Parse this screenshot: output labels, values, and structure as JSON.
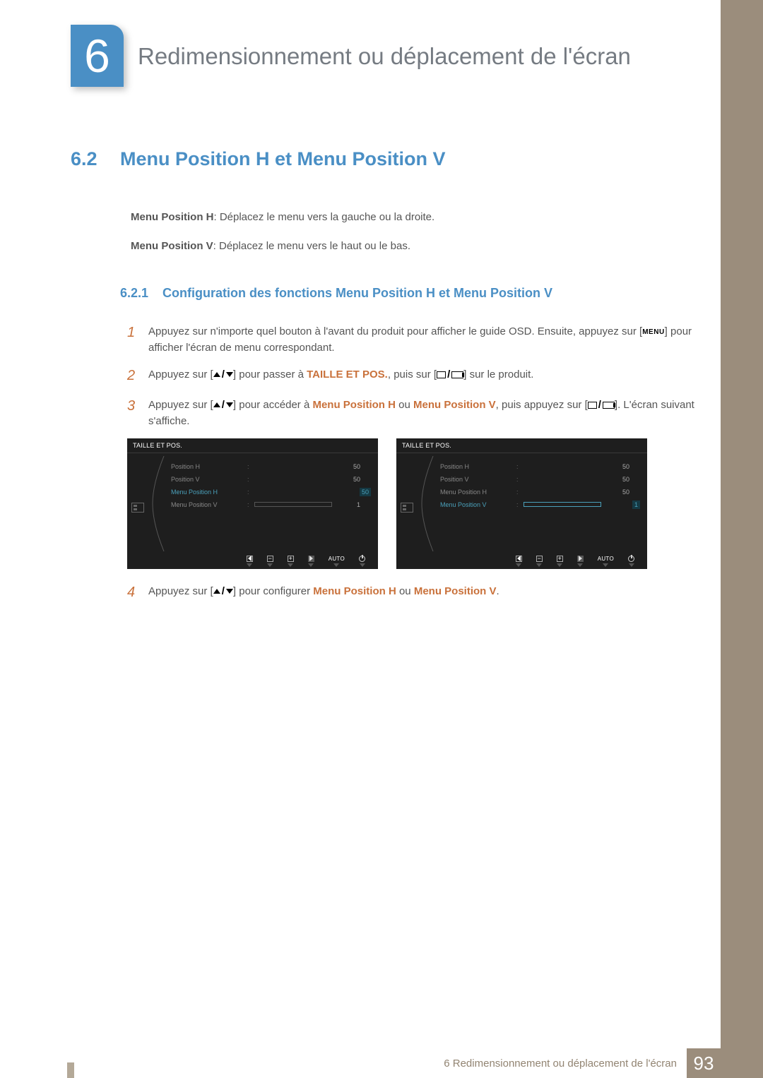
{
  "chapter": {
    "number": "6",
    "title": "Redimensionnement ou déplacement de l'écran"
  },
  "section": {
    "number": "6.2",
    "title": "Menu Position H et Menu Position V"
  },
  "intro": {
    "h_label": "Menu Position H",
    "h_text": ": Déplacez le menu vers la gauche ou la droite.",
    "v_label": "Menu Position V",
    "v_text": ": Déplacez le menu vers le haut ou le bas."
  },
  "subsection": {
    "number": "6.2.1",
    "title": "Configuration des fonctions Menu Position H et Menu Position V"
  },
  "steps": {
    "s1a": "Appuyez sur n'importe quel bouton à l'avant du produit pour afficher le guide OSD. Ensuite, appuyez sur [",
    "menu_chip": "MENU",
    "s1b": "] pour afficher l'écran de menu correspondant.",
    "s2a": "Appuyez sur [",
    "s2b": "] pour passer à ",
    "s2_target": "TAILLE ET POS.",
    "s2c": ", puis sur [",
    "s2d": "] sur le produit.",
    "s3a": "Appuyez sur [",
    "s3b": "] pour accéder à ",
    "s3_h": "Menu Position H",
    "s3_or": " ou ",
    "s3_v": "Menu Position V",
    "s3c": ", puis appuyez sur [",
    "s3d": "]. L'écran suivant s'affiche.",
    "s4a": "Appuyez sur [",
    "s4b": "] pour configurer ",
    "s4_h": "Menu Position H",
    "s4_or": " ou ",
    "s4_v": "Menu Position V",
    "s4c": "."
  },
  "osd": {
    "title": "TAILLE ET POS.",
    "rows": [
      {
        "label": "Position H",
        "value": "50",
        "fill": 50
      },
      {
        "label": "Position V",
        "value": "50",
        "fill": 50
      },
      {
        "label": "Menu Position H",
        "value": "50",
        "fill": 50
      },
      {
        "label": "Menu Position V",
        "value": "1",
        "fill": 2
      }
    ],
    "auto": "AUTO"
  },
  "footer": {
    "text": "6 Redimensionnement ou déplacement de l'écran",
    "page": "93"
  }
}
